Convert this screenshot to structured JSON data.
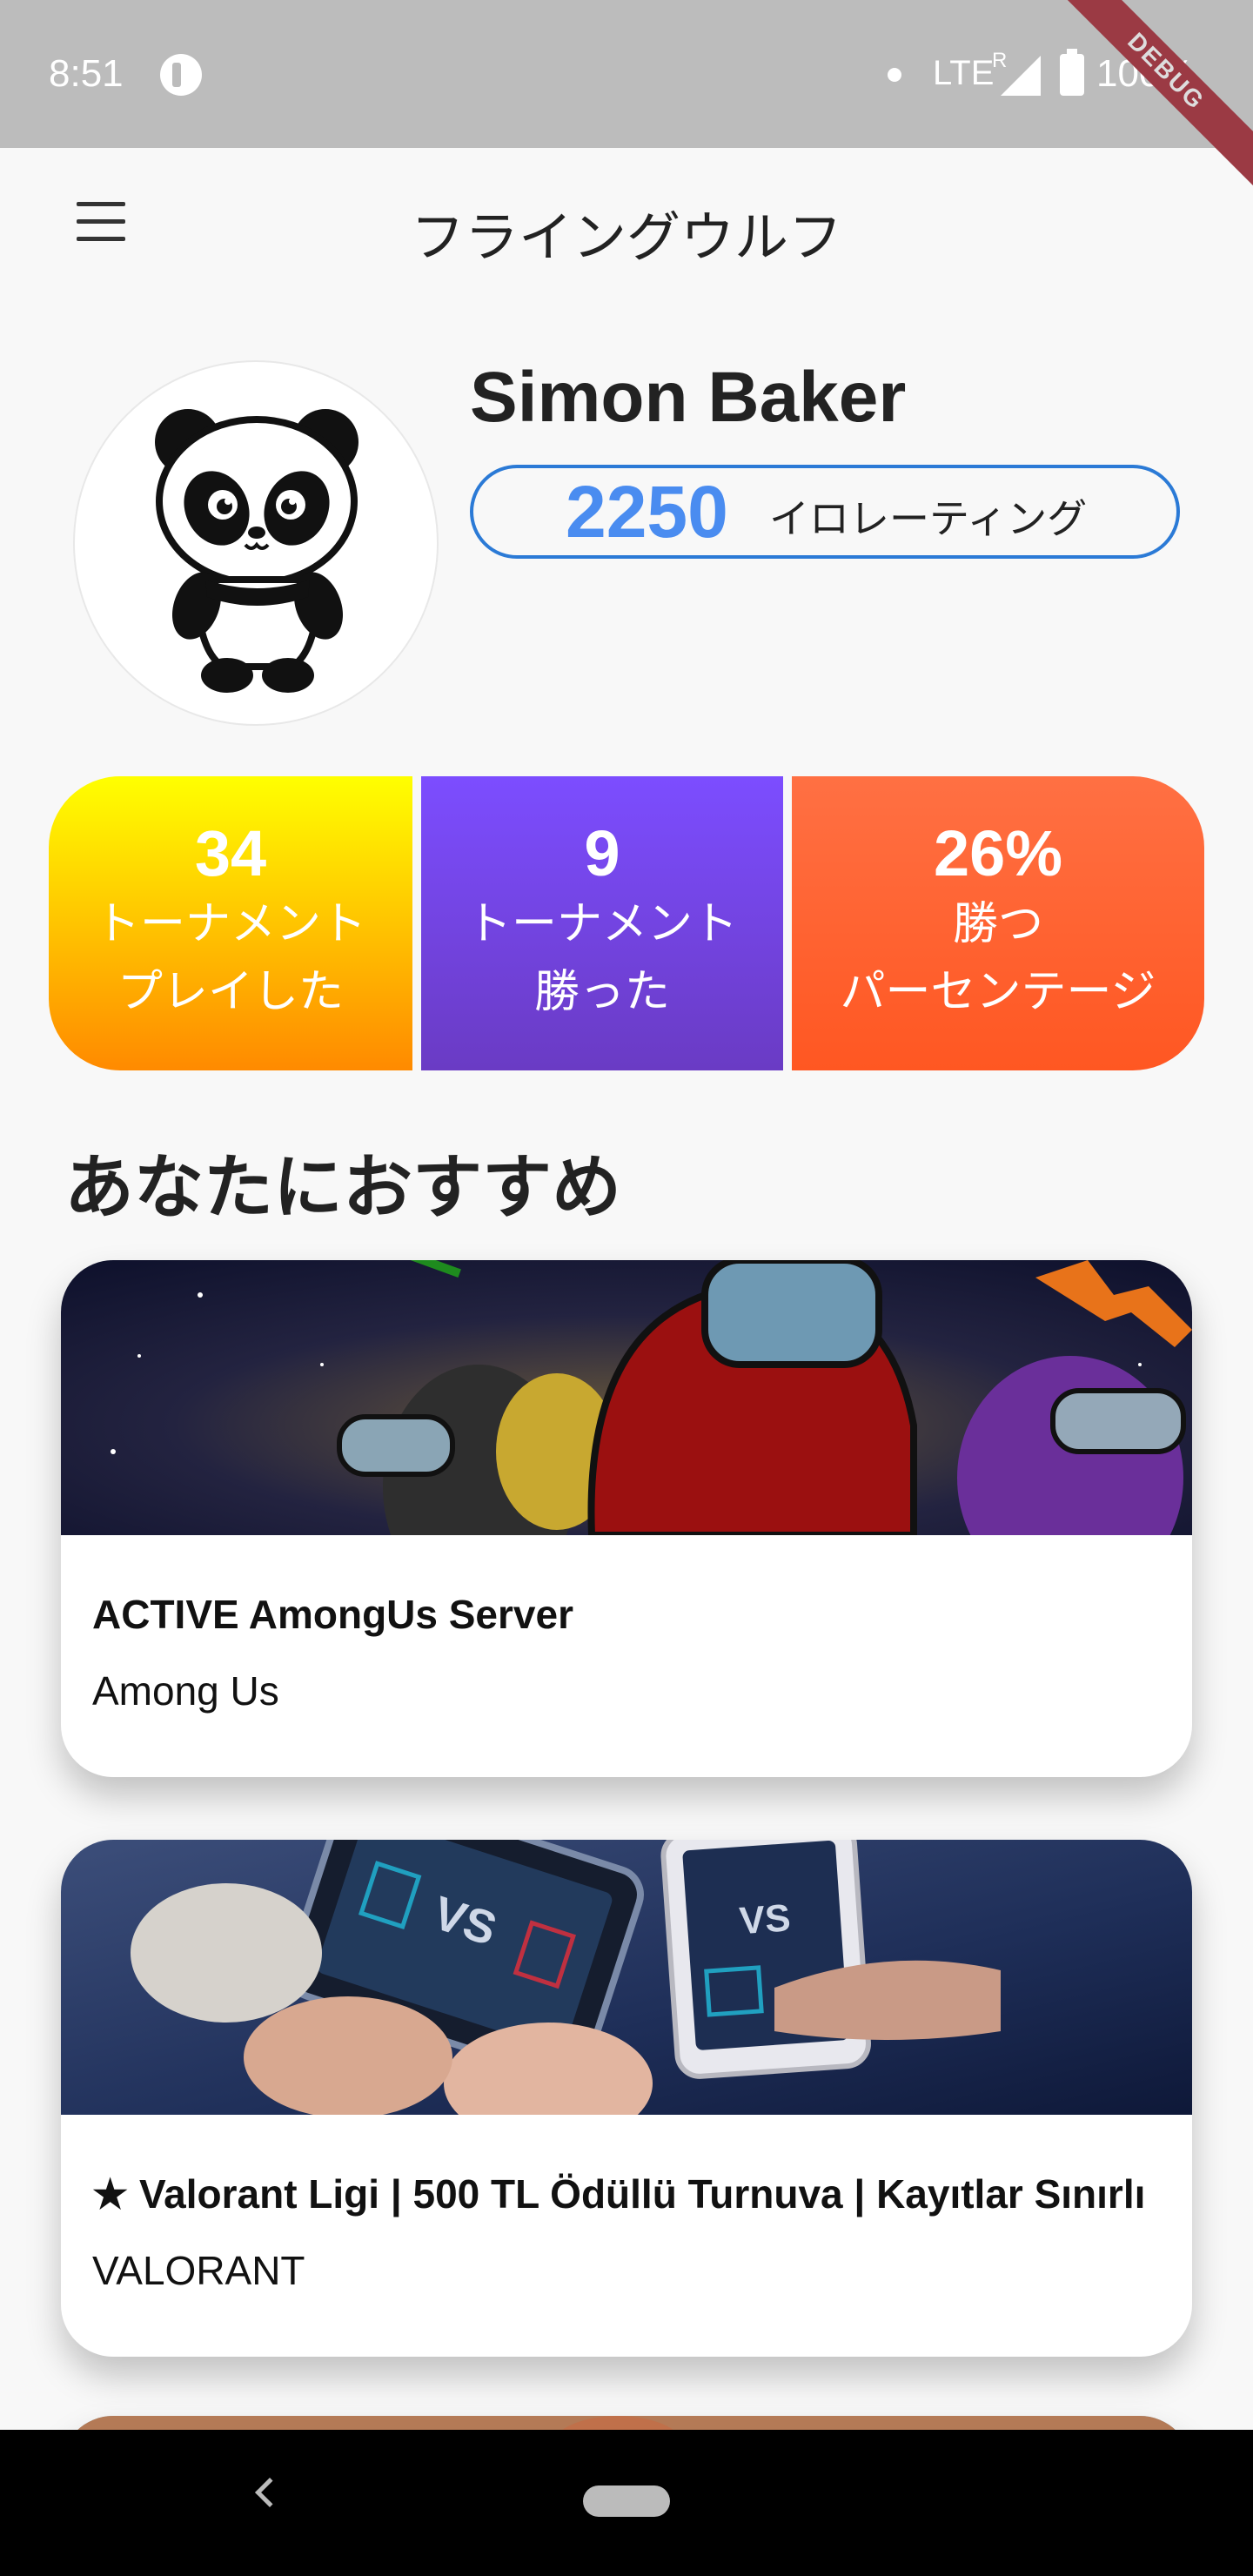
{
  "status_bar": {
    "time": "8:51",
    "network": "LTE",
    "roaming": "R",
    "battery": "100%",
    "debug": "DEBUG"
  },
  "app_bar": {
    "title": "フライングウルフ",
    "menu_icon": "hamburger-menu-icon"
  },
  "profile": {
    "avatar_icon": "panda-avatar",
    "name": "Simon Baker",
    "rating_value": "2250",
    "rating_label": "イロレーティング"
  },
  "stats": [
    {
      "value": "34",
      "line1": "トーナメント",
      "line2": "プレイした",
      "gradient": [
        "#ffff00",
        "#ff8a00"
      ]
    },
    {
      "value": "9",
      "line1": "トーナメント",
      "line2": "勝った",
      "gradient": [
        "#7c4dff",
        "#6a3bc4"
      ]
    },
    {
      "value": "26%",
      "line1": "勝つ",
      "line2": "パーセンテージ",
      "gradient": [
        "#ff7043",
        "#ff5722"
      ]
    }
  ],
  "section_title": "あなたにおすすめ",
  "cards": [
    {
      "title": "ACTIVE AmongUs Server",
      "subtitle": "Among Us",
      "image": "among-us-banner"
    },
    {
      "title": "★ Valorant Ligi | 500 TL Ödüllü Turnuva | Kayıtlar Sınırlı",
      "subtitle": "VALORANT",
      "image": "mobile-gaming-banner"
    },
    {
      "title": "",
      "subtitle": "",
      "image": "partial-banner"
    }
  ],
  "colors": {
    "accent_blue": "#2b7ad6",
    "rating_blue": "#4a8cf0",
    "background": "#f8f8f8"
  }
}
